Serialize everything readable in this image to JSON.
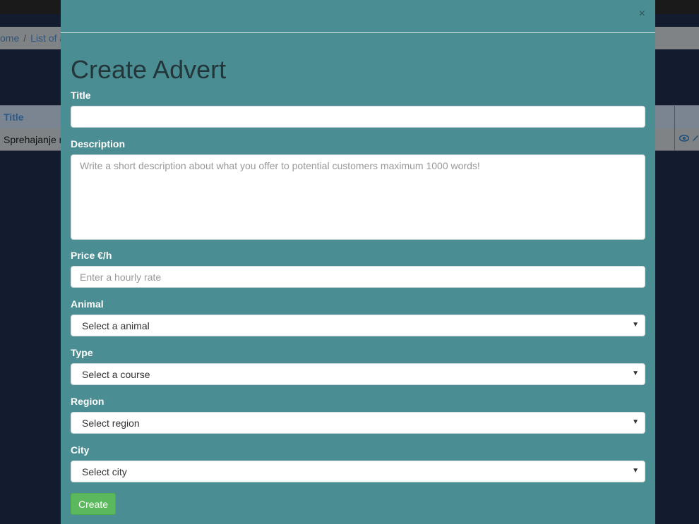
{
  "background": {
    "breadcrumb": {
      "home": "ome",
      "separator": "/",
      "current": "List of a"
    },
    "table": {
      "header_title": "Title",
      "row_title": "Sprehajanje m",
      "icons": [
        "eye-icon",
        "pencil-icon"
      ]
    }
  },
  "modal": {
    "close": "×",
    "title": "Create Advert",
    "fields": {
      "title": {
        "label": "Title",
        "value": "",
        "placeholder": ""
      },
      "description": {
        "label": "Description",
        "placeholder": "Write a short description about what you offer to potential customers maximum 1000 words!"
      },
      "price": {
        "label": "Price €/h",
        "placeholder": "Enter a hourly rate"
      },
      "animal": {
        "label": "Animal",
        "selected": "Select a animal"
      },
      "type": {
        "label": "Type",
        "selected": "Select a course"
      },
      "region": {
        "label": "Region",
        "selected": "Select region"
      },
      "city": {
        "label": "City",
        "selected": "Select city"
      }
    },
    "submit_label": "Create"
  },
  "colors": {
    "modal_bg": "#4a8d93",
    "page_bg": "#131b2e",
    "button_success": "#5cb85c"
  }
}
